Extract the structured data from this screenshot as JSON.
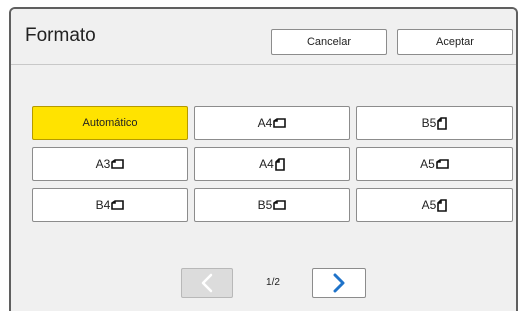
{
  "dialog": {
    "title": "Formato",
    "cancel_label": "Cancelar",
    "accept_label": "Aceptar"
  },
  "formats": [
    {
      "label": "Automático",
      "orientation": "",
      "selected": true
    },
    {
      "label": "A4",
      "orientation": "landscape",
      "selected": false
    },
    {
      "label": "B5",
      "orientation": "portrait",
      "selected": false
    },
    {
      "label": "A3",
      "orientation": "landscape",
      "selected": false
    },
    {
      "label": "A4",
      "orientation": "portrait",
      "selected": false
    },
    {
      "label": "A5",
      "orientation": "landscape",
      "selected": false
    },
    {
      "label": "B4",
      "orientation": "landscape",
      "selected": false
    },
    {
      "label": "B5",
      "orientation": "landscape",
      "selected": false
    },
    {
      "label": "A5",
      "orientation": "portrait",
      "selected": false
    }
  ],
  "pagination": {
    "page_text": "1/2",
    "prev_icon": "chevron-left-icon",
    "next_icon": "chevron-right-icon",
    "prev_enabled": false,
    "next_enabled": true
  },
  "colors": {
    "selected": "#ffe300",
    "accent_arrow": "#1f73c9",
    "background": "#f0f0f0"
  }
}
